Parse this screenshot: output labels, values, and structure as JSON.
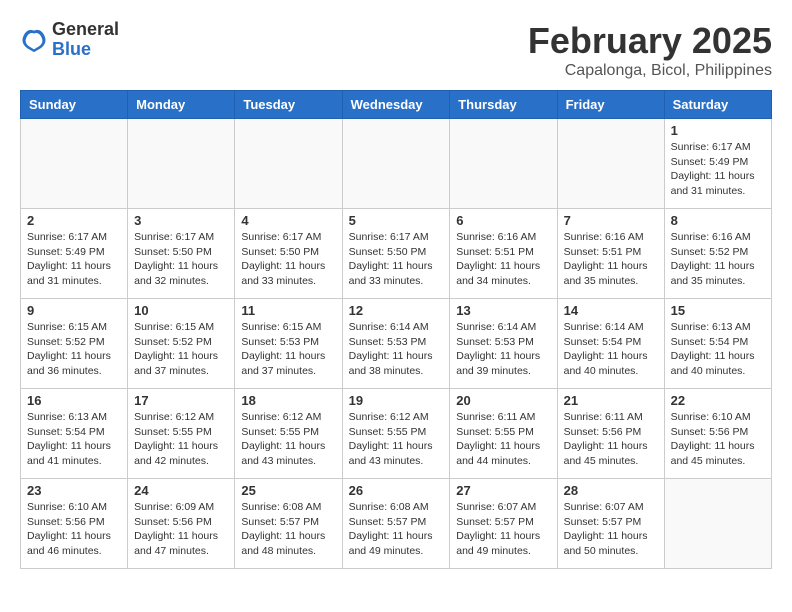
{
  "logo": {
    "general": "General",
    "blue": "Blue"
  },
  "title": "February 2025",
  "subtitle": "Capalonga, Bicol, Philippines",
  "days_header": [
    "Sunday",
    "Monday",
    "Tuesday",
    "Wednesday",
    "Thursday",
    "Friday",
    "Saturday"
  ],
  "weeks": [
    [
      {
        "day": "",
        "info": ""
      },
      {
        "day": "",
        "info": ""
      },
      {
        "day": "",
        "info": ""
      },
      {
        "day": "",
        "info": ""
      },
      {
        "day": "",
        "info": ""
      },
      {
        "day": "",
        "info": ""
      },
      {
        "day": "1",
        "info": "Sunrise: 6:17 AM\nSunset: 5:49 PM\nDaylight: 11 hours and 31 minutes."
      }
    ],
    [
      {
        "day": "2",
        "info": "Sunrise: 6:17 AM\nSunset: 5:49 PM\nDaylight: 11 hours and 31 minutes."
      },
      {
        "day": "3",
        "info": "Sunrise: 6:17 AM\nSunset: 5:50 PM\nDaylight: 11 hours and 32 minutes."
      },
      {
        "day": "4",
        "info": "Sunrise: 6:17 AM\nSunset: 5:50 PM\nDaylight: 11 hours and 33 minutes."
      },
      {
        "day": "5",
        "info": "Sunrise: 6:17 AM\nSunset: 5:50 PM\nDaylight: 11 hours and 33 minutes."
      },
      {
        "day": "6",
        "info": "Sunrise: 6:16 AM\nSunset: 5:51 PM\nDaylight: 11 hours and 34 minutes."
      },
      {
        "day": "7",
        "info": "Sunrise: 6:16 AM\nSunset: 5:51 PM\nDaylight: 11 hours and 35 minutes."
      },
      {
        "day": "8",
        "info": "Sunrise: 6:16 AM\nSunset: 5:52 PM\nDaylight: 11 hours and 35 minutes."
      }
    ],
    [
      {
        "day": "9",
        "info": "Sunrise: 6:15 AM\nSunset: 5:52 PM\nDaylight: 11 hours and 36 minutes."
      },
      {
        "day": "10",
        "info": "Sunrise: 6:15 AM\nSunset: 5:52 PM\nDaylight: 11 hours and 37 minutes."
      },
      {
        "day": "11",
        "info": "Sunrise: 6:15 AM\nSunset: 5:53 PM\nDaylight: 11 hours and 37 minutes."
      },
      {
        "day": "12",
        "info": "Sunrise: 6:14 AM\nSunset: 5:53 PM\nDaylight: 11 hours and 38 minutes."
      },
      {
        "day": "13",
        "info": "Sunrise: 6:14 AM\nSunset: 5:53 PM\nDaylight: 11 hours and 39 minutes."
      },
      {
        "day": "14",
        "info": "Sunrise: 6:14 AM\nSunset: 5:54 PM\nDaylight: 11 hours and 40 minutes."
      },
      {
        "day": "15",
        "info": "Sunrise: 6:13 AM\nSunset: 5:54 PM\nDaylight: 11 hours and 40 minutes."
      }
    ],
    [
      {
        "day": "16",
        "info": "Sunrise: 6:13 AM\nSunset: 5:54 PM\nDaylight: 11 hours and 41 minutes."
      },
      {
        "day": "17",
        "info": "Sunrise: 6:12 AM\nSunset: 5:55 PM\nDaylight: 11 hours and 42 minutes."
      },
      {
        "day": "18",
        "info": "Sunrise: 6:12 AM\nSunset: 5:55 PM\nDaylight: 11 hours and 43 minutes."
      },
      {
        "day": "19",
        "info": "Sunrise: 6:12 AM\nSunset: 5:55 PM\nDaylight: 11 hours and 43 minutes."
      },
      {
        "day": "20",
        "info": "Sunrise: 6:11 AM\nSunset: 5:55 PM\nDaylight: 11 hours and 44 minutes."
      },
      {
        "day": "21",
        "info": "Sunrise: 6:11 AM\nSunset: 5:56 PM\nDaylight: 11 hours and 45 minutes."
      },
      {
        "day": "22",
        "info": "Sunrise: 6:10 AM\nSunset: 5:56 PM\nDaylight: 11 hours and 45 minutes."
      }
    ],
    [
      {
        "day": "23",
        "info": "Sunrise: 6:10 AM\nSunset: 5:56 PM\nDaylight: 11 hours and 46 minutes."
      },
      {
        "day": "24",
        "info": "Sunrise: 6:09 AM\nSunset: 5:56 PM\nDaylight: 11 hours and 47 minutes."
      },
      {
        "day": "25",
        "info": "Sunrise: 6:08 AM\nSunset: 5:57 PM\nDaylight: 11 hours and 48 minutes."
      },
      {
        "day": "26",
        "info": "Sunrise: 6:08 AM\nSunset: 5:57 PM\nDaylight: 11 hours and 49 minutes."
      },
      {
        "day": "27",
        "info": "Sunrise: 6:07 AM\nSunset: 5:57 PM\nDaylight: 11 hours and 49 minutes."
      },
      {
        "day": "28",
        "info": "Sunrise: 6:07 AM\nSunset: 5:57 PM\nDaylight: 11 hours and 50 minutes."
      },
      {
        "day": "",
        "info": ""
      }
    ]
  ]
}
